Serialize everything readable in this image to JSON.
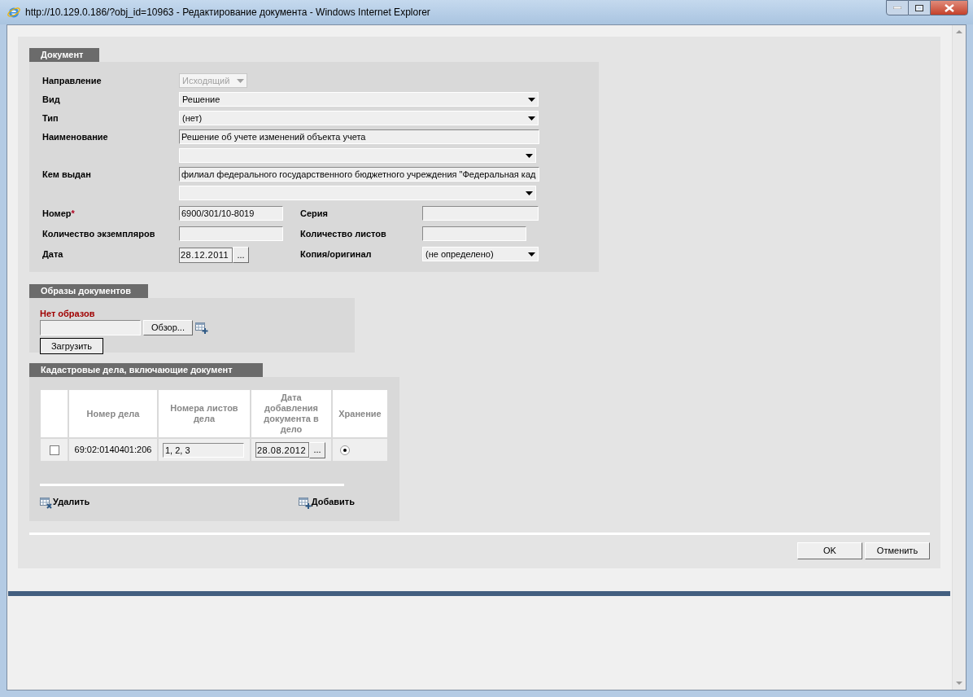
{
  "window": {
    "title": "http://10.129.0.186/?obj_id=10963 - Редактирование документа - Windows Internet Explorer"
  },
  "document": {
    "title": "Документ",
    "required_mark": "*",
    "rows": [
      {
        "label": "Направление",
        "kind": "compact_select",
        "value": "Исходящий",
        "disabled": true
      },
      {
        "label": "Вид",
        "kind": "select",
        "value": "Решение",
        "disabled": false
      },
      {
        "label": "Тип",
        "kind": "select",
        "value": "(нет)",
        "disabled": false
      },
      {
        "label": "Наименование",
        "kind": "text",
        "value": "Решение об учете изменений объекта учета"
      },
      {
        "kind": "select",
        "disabled": false
      },
      {
        "label": "Кем выдан",
        "kind": "text",
        "value": "филиал федерального государственного бюджетного учреждения \"Федеральная кад"
      },
      {
        "kind": "select",
        "disabled": false
      }
    ],
    "grid": [
      {
        "label": "Номер",
        "required": true,
        "kind": "text",
        "value": "6900/301/10-8019"
      },
      {
        "label": "Серия",
        "required": false,
        "kind": "text"
      },
      {
        "label": "Количество экземпляров",
        "required": false,
        "kind": "text"
      },
      {
        "label": "Количество листов",
        "required": false,
        "kind": "short"
      },
      {
        "label": "Дата",
        "required": false,
        "kind": "date",
        "value": "28.12.2011",
        "picker": "..."
      },
      {
        "label": "Копия/оригинал",
        "required": false,
        "kind": "select",
        "value": "(не определено)"
      }
    ]
  },
  "images": {
    "title": "Образы документов",
    "empty_text": "Нет образов",
    "browse_button": "Обзор...",
    "upload_button": "Загрузить"
  },
  "cases": {
    "title": "Кадастровые дела, включающие документ",
    "columns": [
      "Номер дела",
      "Номера листов дела",
      "Дата добавления документа в дело",
      "Хранение"
    ],
    "rows": [
      {
        "checked": false,
        "case_number": "69:02:0140401:206",
        "sheets": "1, 2, 3",
        "date": "28.08.2012",
        "picker": "...",
        "storage_selected": true
      }
    ],
    "delete_button": "Удалить",
    "add_button": "Добавить"
  },
  "footer": {
    "buttons": [
      "OK",
      "Отменить"
    ]
  }
}
